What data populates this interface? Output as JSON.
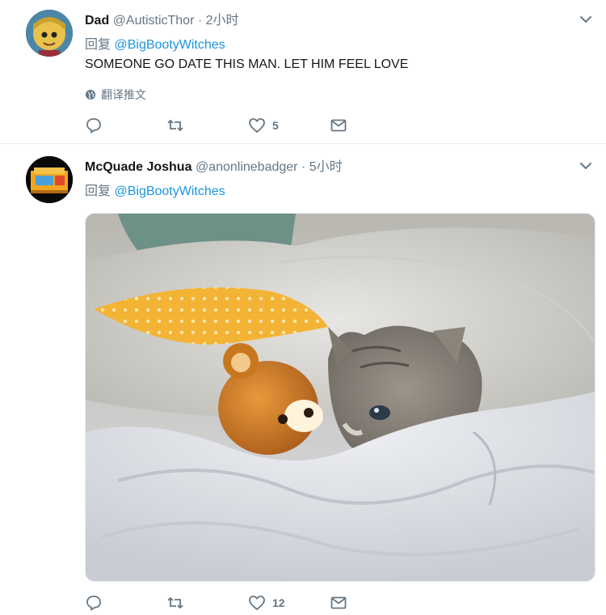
{
  "tweets": [
    {
      "name": "Dad",
      "handle": "@AutisticThor",
      "time": "· 2小时",
      "reply_prefix": "回复",
      "reply_to": "@BigBootyWitches",
      "text": "SOMEONE GO DATE THIS MAN. LET HIM FEEL LOVE",
      "translate": "翻译推文",
      "likes": "5"
    },
    {
      "name": "McQuade Joshua",
      "handle": "@anonlinebadger",
      "time": "· 5小时",
      "reply_prefix": "回复",
      "reply_to": "@BigBootyWitches",
      "likes": "12"
    }
  ],
  "colors": {
    "link": "#1b95e0",
    "muted": "#657786",
    "text": "#14171a"
  },
  "icons": [
    "reply-icon",
    "retweet-icon",
    "like-icon",
    "direct-message-icon",
    "globe-icon",
    "chevron-down-icon"
  ]
}
